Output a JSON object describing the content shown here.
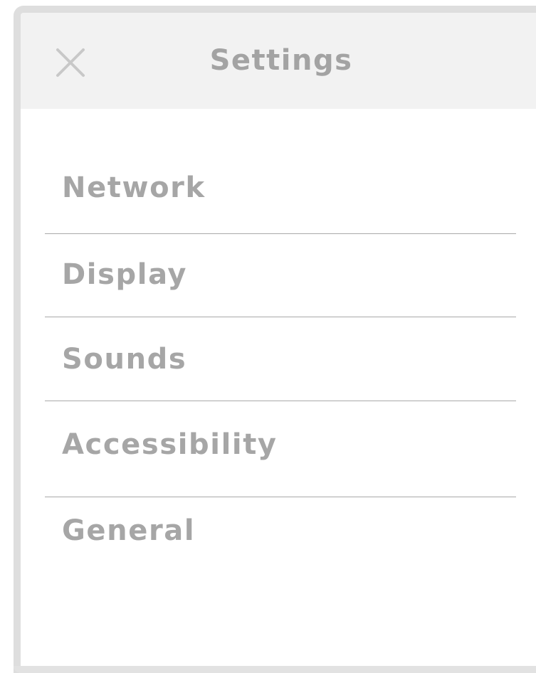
{
  "header": {
    "title": "Settings",
    "close_icon": "close-icon"
  },
  "menu": {
    "items": [
      {
        "label": "Network"
      },
      {
        "label": "Display"
      },
      {
        "label": "Sounds"
      },
      {
        "label": "Accessibility"
      },
      {
        "label": "General"
      }
    ]
  },
  "colors": {
    "header_background": "#f2f2f2",
    "text": "#a6a6a6",
    "divider": "#a9a9a9",
    "frame": "#dedede"
  }
}
